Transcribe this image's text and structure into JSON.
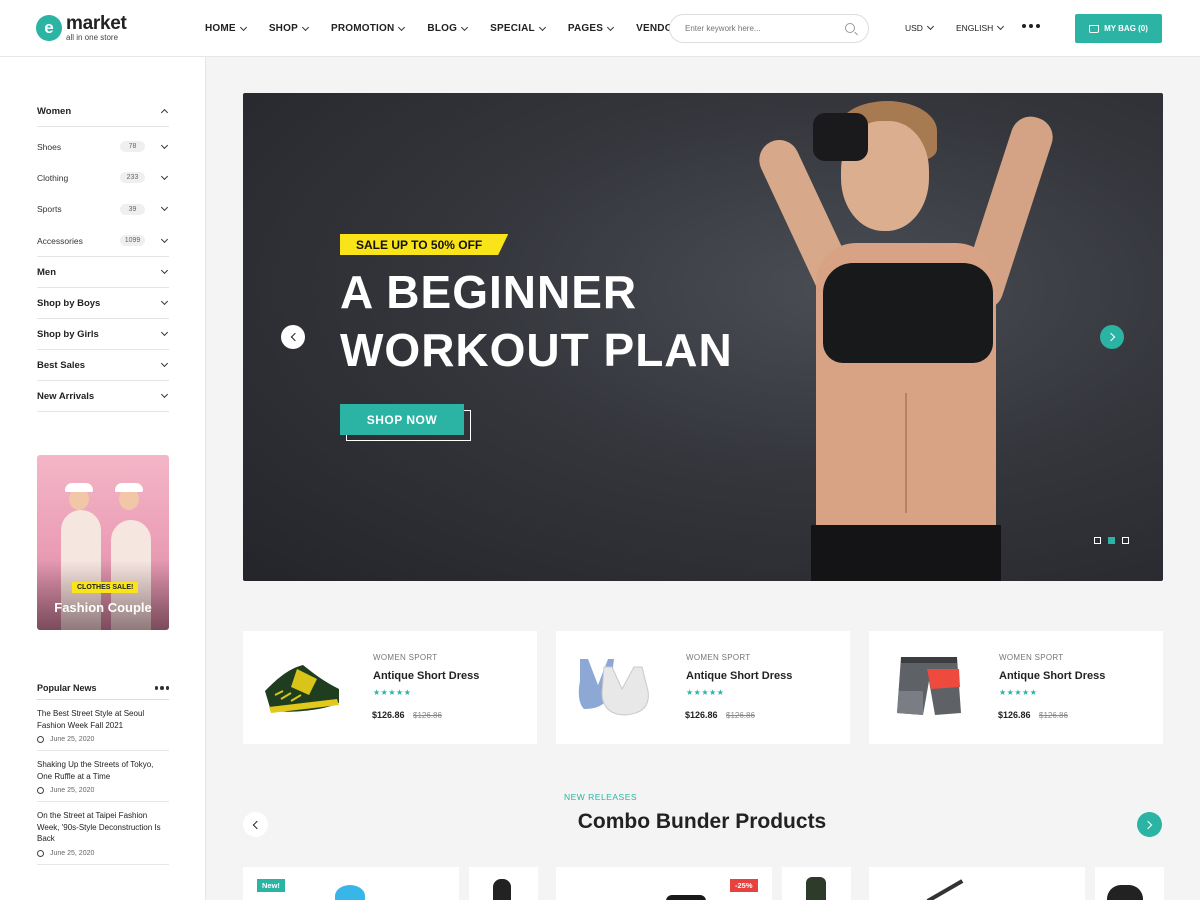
{
  "header": {
    "logo_name": "market",
    "logo_tagline": "all in one store",
    "nav": [
      "HOME",
      "SHOP",
      "PROMOTION",
      "BLOG",
      "SPECIAL",
      "PAGES",
      "VENDOR"
    ],
    "search_placeholder": "Enter keywork here...",
    "currency": "USD",
    "language": "ENGLISH",
    "bag_label": "MY BAG (0)"
  },
  "sidebar": {
    "women_label": "Women",
    "women_subcategories": [
      {
        "label": "Shoes",
        "count": "78"
      },
      {
        "label": "Clothing",
        "count": "233"
      },
      {
        "label": "Sports",
        "count": "39"
      },
      {
        "label": "Accessories",
        "count": "1099"
      }
    ],
    "categories": [
      "Men",
      "Shop by Boys",
      "Shop by Girls",
      "Best Sales",
      "New Arrivals"
    ],
    "promo": {
      "badge": "CLOTHES SALE!",
      "title": "Fashion Couple"
    },
    "news": {
      "heading": "Popular News",
      "items": [
        {
          "title": "The Best Street Style at Seoul Fashion Week Fall 2021",
          "date": "June 25, 2020"
        },
        {
          "title": "Shaking Up the Streets of Tokyo, One Ruffle at a Time",
          "date": "June 25, 2020"
        },
        {
          "title": "On the Street at Taipei Fashion Week, '90s-Style Deconstruction Is Back",
          "date": "June 25, 2020"
        }
      ]
    }
  },
  "hero": {
    "badge": "SALE UP TO 50% OFF",
    "title_line1": "A BEGINNER",
    "title_line2": "WORKOUT PLAN",
    "button": "SHOP NOW",
    "slide_count": 3,
    "active_slide": 2
  },
  "products": [
    {
      "category": "WOMEN SPORT",
      "name": "Antique Short Dress",
      "stars": "★★★★★",
      "price": "$126.86",
      "old_price": "$126.86",
      "image": "sneaker"
    },
    {
      "category": "WOMEN SPORT",
      "name": "Antique Short Dress",
      "stars": "★★★★★",
      "price": "$126.86",
      "old_price": "$126.86",
      "image": "sports-bra"
    },
    {
      "category": "WOMEN SPORT",
      "name": "Antique Short Dress",
      "stars": "★★★★★",
      "price": "$126.86",
      "old_price": "$126.86",
      "image": "shorts"
    }
  ],
  "combo": {
    "subtitle": "NEW RELEASES",
    "title": "Combo Bunder Products",
    "badges": [
      "New!",
      "-25%"
    ]
  },
  "colors": {
    "accent": "#2bb3a3",
    "badge_yellow": "#f9e41a",
    "sale_red": "#e8423f"
  }
}
